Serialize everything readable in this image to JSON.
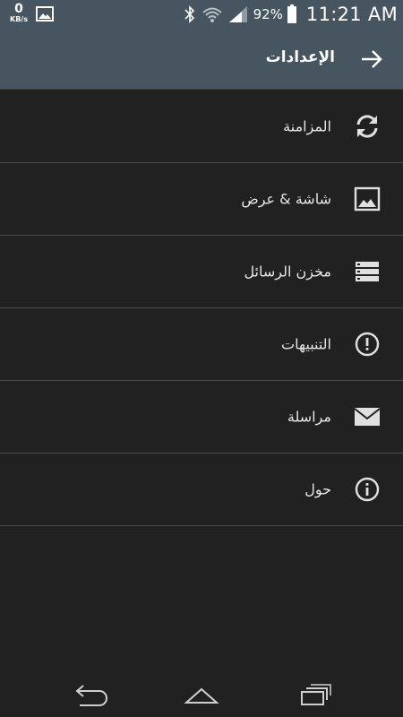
{
  "status_bar": {
    "net_speed_value": "0",
    "net_speed_unit": "KB/s",
    "battery_percent": "92%",
    "time": "11:21 AM",
    "icons": [
      "gallery-icon",
      "bluetooth-icon",
      "wifi-icon",
      "signal-icon",
      "battery-icon"
    ]
  },
  "action_bar": {
    "title": "الإعدادات",
    "back_icon": "arrow-right-icon"
  },
  "settings": {
    "items": [
      {
        "label": "المزامنة",
        "icon": "sync-icon"
      },
      {
        "label": "شاشة & عرض",
        "icon": "image-icon"
      },
      {
        "label": "مخزن الرسائل",
        "icon": "storage-icon"
      },
      {
        "label": "التنبيهات",
        "icon": "alert-icon"
      },
      {
        "label": "مراسلة",
        "icon": "mail-icon"
      },
      {
        "label": "حول",
        "icon": "info-icon"
      }
    ]
  },
  "nav_bar": {
    "icons": [
      "back-icon",
      "home-icon",
      "recent-apps-icon"
    ]
  },
  "colors": {
    "header_bg": "#46555f",
    "list_bg": "#212121",
    "divider": "#4a4a4a",
    "text": "#e6e6e6"
  }
}
